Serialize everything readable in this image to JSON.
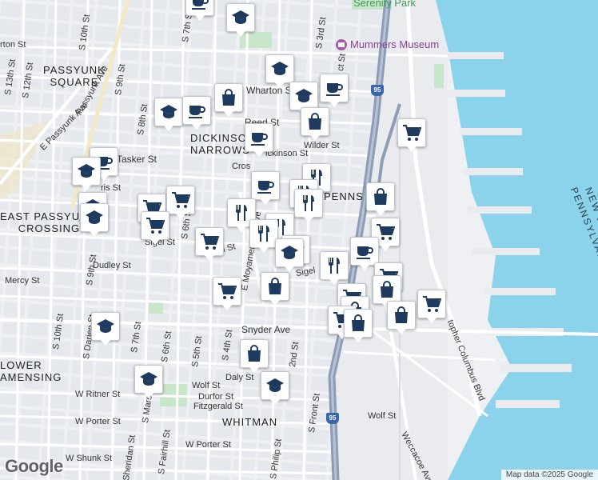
{
  "colors": {
    "water": "#8bd3ea",
    "land": "#eef0f3",
    "block": "#e4e7ec",
    "street": "#ffffff",
    "highway": "#8d9db5",
    "park": "#c8e6c9",
    "marker_icon": "#1e3a5f"
  },
  "area_labels": {
    "passyunk_square": "PASSYUNK\nSQUARE",
    "dickinson_narrows": "DICKINSON\nNARROWS",
    "east_passyunk_crossing": "EAST PASSYU\nCROSSING",
    "pennsport": "PENNS",
    "lower_moyamensing": "LOWER\nAMENSING",
    "whitman": "WHITMAN",
    "new_jersey": "NEW JE",
    "pennsylvania": "PENNSYLVANIA"
  },
  "poi_labels": {
    "mummers_museum": "Mummers Museum",
    "serenity_park": "Serenity Park"
  },
  "highway_shields": [
    "95",
    "95"
  ],
  "street_labels": {
    "s_10th_st": "S 10th St",
    "s_9th_st": "S 9th St",
    "s_12th_st": "S 12th St",
    "s_13th_st": "S 13th St",
    "e_passyunk_ave": "E Passyunk Ave",
    "passyunk_ave": "Passyunk Ave",
    "s_8th_st": "S 8th St",
    "s_7th_st": "S 7th St",
    "s_3rd_st": "S 3rd St",
    "wharton_st": "Wharton St",
    "reed_st": "Reed St",
    "dickinson_st": "ickinson St",
    "wilder_st": "Wilder St",
    "tasker_st": "Tasker St",
    "morris_st": "ris St",
    "cross_st": "Cros",
    "sigel_st_w": "Sigel St",
    "sigel_st_m": "Sigel St",
    "sigel_st_e": "Sigel",
    "s_6th_st": "S 6th St",
    "dudley_st": "Dudley St",
    "mercy_st": "Mercy St",
    "e_moyamensing_ave": "E Moyamensing Ave",
    "s_9th_st_b": "S 9th St",
    "snyder_ave": "Snyder Ave",
    "s_10th_st_b": "S 10th St",
    "s_darien_st": "S Darien St",
    "s_7th_st_b": "S 7th St",
    "s_6th_st_b": "S 6th St",
    "s_5th_st": "S 5th St",
    "s_4th_st": "S 4th St",
    "s_2nd_st": "2nd St",
    "daly_st": "Daly St",
    "wolf_st_w": "Wolf St",
    "w_ritner_st": "W Ritner St",
    "durfor_st": "Durfor St",
    "fitzgerald_st": "Fitzgerald St",
    "w_porter_st": "W Porter St",
    "w_porter_st_b": "W Porter St",
    "w_shunk_st": "W Shunk St",
    "s_marshall": "S Mars",
    "s_sheridan_st": "Sheridan St",
    "s_fairhill_st": "S Fairhill St",
    "s_philip_st": "S Philip St",
    "s_front_st": "S Front St",
    "wolf_st_e": "Wolf St",
    "weccacoe_ave": "Weccacoe Ave",
    "columbus_blvd": "topher Columbus Blvd",
    "wharton_top": "rton St",
    "s_front_top": "ct St",
    "st_small": "St",
    "s_e": "S",
    "w_lbl": "W"
  },
  "markers": [
    {
      "icon": "coffee"
    },
    {
      "icon": "school"
    },
    {
      "icon": "school"
    },
    {
      "icon": "shopping-bag"
    },
    {
      "icon": "school"
    },
    {
      "icon": "coffee"
    },
    {
      "icon": "school"
    },
    {
      "icon": "coffee"
    },
    {
      "icon": "coffee"
    },
    {
      "icon": "shopping-bag"
    },
    {
      "icon": "shopping-cart"
    },
    {
      "icon": "coffee"
    },
    {
      "icon": "school"
    },
    {
      "icon": "coffee"
    },
    {
      "icon": "restaurant"
    },
    {
      "icon": "restaurant"
    },
    {
      "icon": "restaurant"
    },
    {
      "icon": "shopping-bag"
    },
    {
      "icon": "school"
    },
    {
      "icon": "school"
    },
    {
      "icon": "shopping-cart"
    },
    {
      "icon": "shopping-cart"
    },
    {
      "icon": "shopping-cart"
    },
    {
      "icon": "restaurant"
    },
    {
      "icon": "restaurant"
    },
    {
      "icon": "restaurant"
    },
    {
      "icon": "shopping-cart"
    },
    {
      "icon": "school"
    },
    {
      "icon": "school"
    },
    {
      "icon": "shopping-cart"
    },
    {
      "icon": "coffee"
    },
    {
      "icon": "restaurant"
    },
    {
      "icon": "shopping-bag"
    },
    {
      "icon": "shopping-cart"
    },
    {
      "icon": "shopping-cart"
    },
    {
      "icon": "shopping-bag"
    },
    {
      "icon": "shopping-cart"
    },
    {
      "icon": "shopping-bag"
    },
    {
      "icon": "shopping-cart"
    },
    {
      "icon": "shopping-bag"
    },
    {
      "icon": "shopping-bag"
    },
    {
      "icon": "shopping-cart"
    },
    {
      "icon": "school"
    },
    {
      "icon": "shopping-bag"
    },
    {
      "icon": "school"
    },
    {
      "icon": "school"
    }
  ],
  "branding": {
    "logo": "Google",
    "attribution": "Map data ©2025 Google"
  }
}
